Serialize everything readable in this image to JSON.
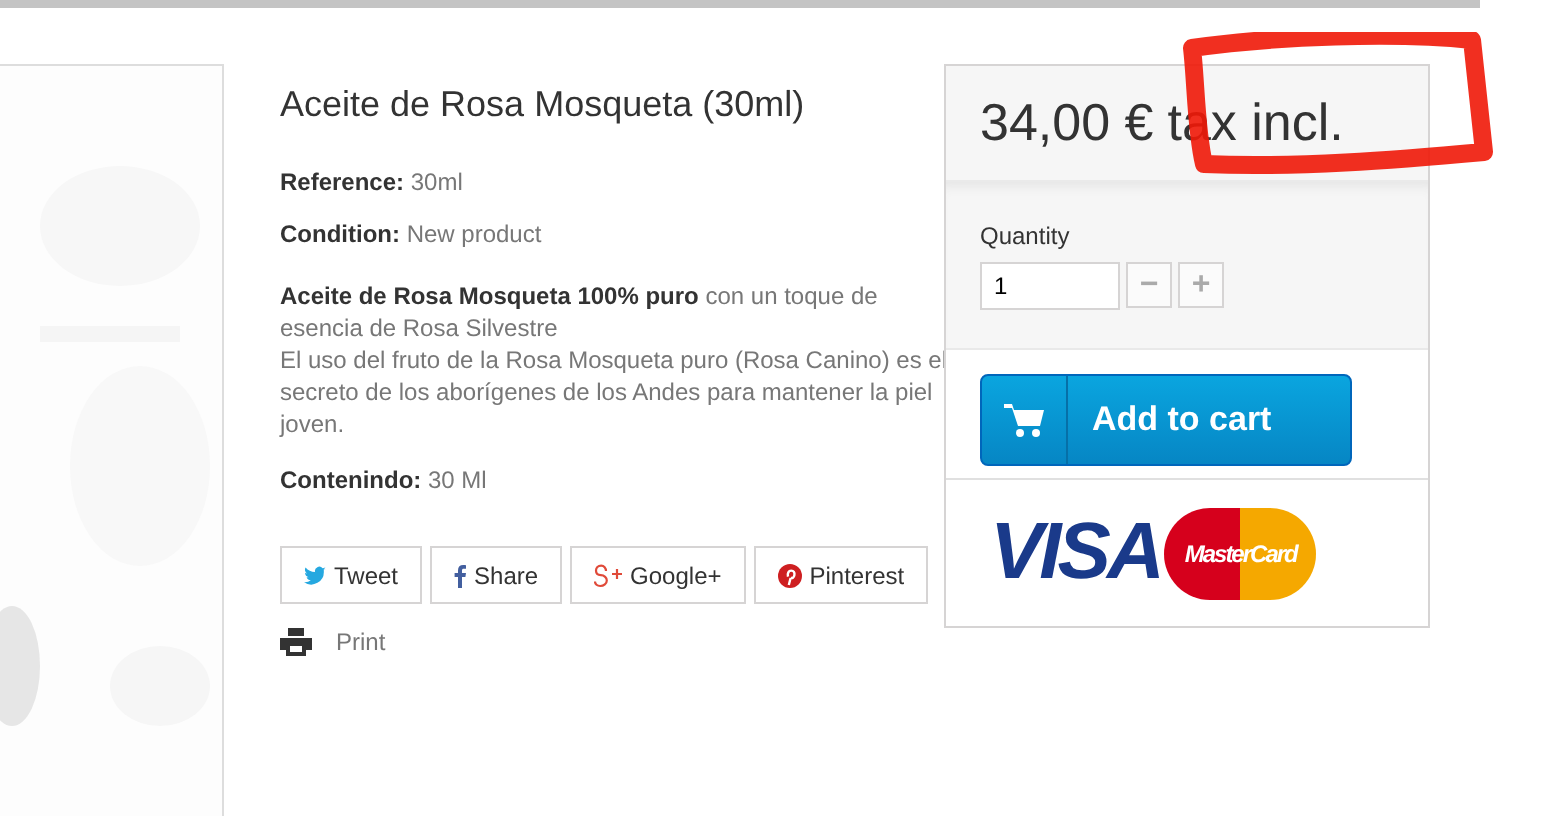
{
  "product": {
    "title": "Aceite de Rosa Mosqueta (30ml)",
    "details": [
      {
        "label": "Reference:",
        "value": "30ml"
      },
      {
        "label": "Condition:",
        "value": "New product"
      }
    ],
    "description": [
      "**Aceite de Rosa Mosqueta 100% puro** con un toque de esencia de Rosa Silvestre",
      "El uso del fruto de la Rosa Mosqueta puro (Rosa Canino) es el secreto de los aborígenes de los Andes para mantener la piel joven."
    ],
    "content": {
      "label": "Contenindo:",
      "value": "30 Ml"
    }
  },
  "share_buttons": [
    {
      "kind": "twitter",
      "label": "Tweet"
    },
    {
      "kind": "facebook",
      "label": "Share"
    },
    {
      "kind": "googleplus",
      "label": "Google+"
    },
    {
      "kind": "pinterest",
      "label": "Pinterest"
    }
  ],
  "print": {
    "label": "Print"
  },
  "buy_box": {
    "price": "34,00 €",
    "tax": "tax incl.",
    "quantity_label": "Quantity",
    "quantity": "1",
    "minus": "−",
    "plus": "+",
    "add_to_cart": "Add to cart",
    "payment_logos": [
      "VISA",
      "MasterCard"
    ]
  }
}
